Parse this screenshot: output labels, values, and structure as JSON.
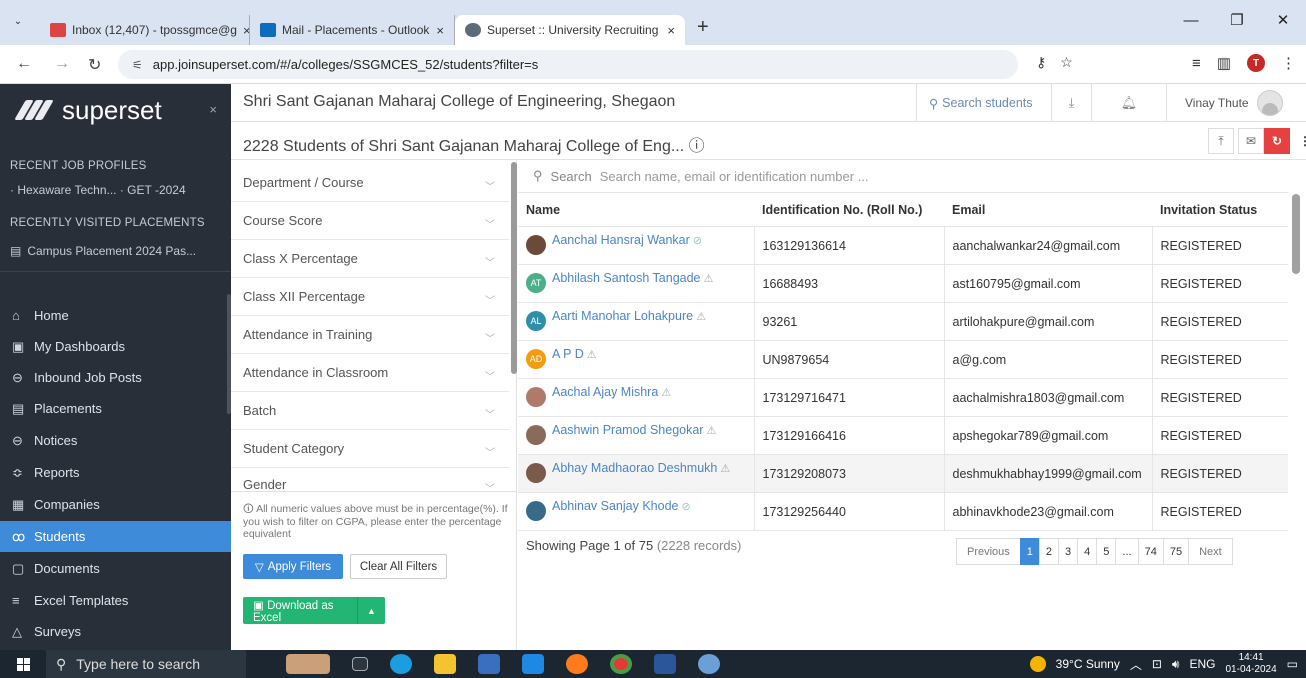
{
  "browser": {
    "tabs": [
      {
        "title": "Inbox (12,407) - tpossgmce@g",
        "close": "×",
        "active": false,
        "fav_color": "#d44"
      },
      {
        "title": "Mail - Placements - Outlook",
        "close": "×",
        "active": false,
        "fav_color": "#0f6cbd"
      },
      {
        "title": "Superset :: University Recruiting",
        "close": "×",
        "active": true,
        "fav_color": "#5c6b7a"
      }
    ],
    "new_tab": "+",
    "url": "app.joinsuperset.com/#/a/colleges/SSGMCES_52/students?filter=s",
    "profile_initial": "T"
  },
  "sidebar": {
    "brand": "superset",
    "close": "×",
    "recent_job_profiles_title": "RECENT JOB PROFILES",
    "recent_job_profile": "· Hexaware Techn...  · GET -2024",
    "recent_placements_title": "RECENTLY VISITED PLACEMENTS",
    "recent_placement": "Campus Placement 2024 Pas...",
    "items": [
      {
        "label": "Home",
        "icon": "home-icon",
        "glyph": "⌂"
      },
      {
        "label": "My Dashboards",
        "icon": "dashboard-icon",
        "glyph": "▣"
      },
      {
        "label": "Inbound Job Posts",
        "icon": "inbox-icon",
        "glyph": "⊖"
      },
      {
        "label": "Placements",
        "icon": "placements-icon",
        "glyph": "▤"
      },
      {
        "label": "Notices",
        "icon": "notices-icon",
        "glyph": "⊖"
      },
      {
        "label": "Reports",
        "icon": "reports-icon",
        "glyph": "≎"
      },
      {
        "label": "Companies",
        "icon": "companies-icon",
        "glyph": "▦"
      },
      {
        "label": "Students",
        "icon": "students-icon",
        "glyph": "ꝏ"
      },
      {
        "label": "Documents",
        "icon": "documents-icon",
        "glyph": "▢"
      },
      {
        "label": "Excel Templates",
        "icon": "templates-icon",
        "glyph": "≡"
      },
      {
        "label": "Surveys",
        "icon": "surveys-icon",
        "glyph": "△"
      }
    ],
    "active_item": "Students"
  },
  "header": {
    "college_name": "Shri Sant Gajanan Maharaj College of Engineering, Shegaon",
    "search_label": "Search students",
    "user_name": "Vinay Thute"
  },
  "subheader": {
    "title": "2228 Students of Shri Sant Gajanan Maharaj College of Eng... ⓘ"
  },
  "filters": {
    "items": [
      "Department / Course",
      "Course Score",
      "Class X Percentage",
      "Class XII Percentage",
      "Attendance in Training",
      "Attendance in Classroom",
      "Batch",
      "Student Category",
      "Gender"
    ],
    "note": "All numeric values above must be in percentage(%). If you wish to filter on CGPA, please enter the percentage equivalent",
    "apply_label": "Apply Filters",
    "clear_label": "Clear All Filters",
    "download_label": "Download as Excel"
  },
  "table": {
    "search_label": "Search",
    "search_placeholder": "Search name, email or identification number ...",
    "columns": [
      "Name",
      "Identification No. (Roll No.)",
      "Email",
      "Invitation Status"
    ],
    "rows": [
      {
        "name": "Aanchal Hansraj Wankar",
        "mark": "⊘",
        "mark_type": "ok",
        "avatar": "photo",
        "avatar_color": "#6b4a3a",
        "id": "163129136614",
        "email": "aanchalwankar24@gmail.com",
        "status": "REGISTERED"
      },
      {
        "name": "Abhilash Santosh Tangade",
        "mark": "⚠",
        "mark_type": "warn",
        "avatar": "AT",
        "avatar_color": "#4caf8a",
        "id": "16688493",
        "email": "ast160795@gmail.com",
        "status": "REGISTERED"
      },
      {
        "name": "Aarti Manohar Lohakpure",
        "mark": "⚠",
        "mark_type": "warn",
        "avatar": "AL",
        "avatar_color": "#2f8fa8",
        "id": "93261",
        "email": "artilohakpure@gmail.com",
        "status": "REGISTERED"
      },
      {
        "name": "A P D",
        "mark": "⚠",
        "mark_type": "warn",
        "avatar": "AD",
        "avatar_color": "#f39c12",
        "id": "UN9879654",
        "email": "a@g.com",
        "status": "REGISTERED"
      },
      {
        "name": "Aachal Ajay Mishra",
        "mark": "⚠",
        "mark_type": "warn",
        "avatar": "photo",
        "avatar_color": "#b07a6a",
        "id": "173129716471",
        "email": "aachalmishra1803@gmail.com",
        "status": "REGISTERED"
      },
      {
        "name": "Aashwin Pramod Shegokar",
        "mark": "⚠",
        "mark_type": "warn",
        "avatar": "photo",
        "avatar_color": "#8a6a5a",
        "id": "173129166416",
        "email": "apshegokar789@gmail.com",
        "status": "REGISTERED"
      },
      {
        "name": "Abhay Madhaorao Deshmukh",
        "mark": "⚠",
        "mark_type": "warn",
        "avatar": "photo",
        "avatar_color": "#7a5a4a",
        "id": "173129208073",
        "email": "deshmukhabhay1999@gmail.com",
        "status": "REGISTERED"
      },
      {
        "name": "Abhinav Sanjay Khode",
        "mark": "⊘",
        "mark_type": "ok",
        "avatar": "photo",
        "avatar_color": "#3a6a8a",
        "id": "173129256440",
        "email": "abhinavkhode23@gmail.com",
        "status": "REGISTERED"
      }
    ],
    "showing_prefix": "Showing Page 1 of 75",
    "showing_records": "(2228 records)"
  },
  "pagination": {
    "previous": "Previous",
    "pages": [
      "1",
      "2",
      "3",
      "4",
      "5",
      "...",
      "74",
      "75"
    ],
    "current": "1",
    "next": "Next"
  },
  "taskbar": {
    "search_placeholder": "Type here to search",
    "weather": "39°C  Sunny",
    "lang": "ENG",
    "time": "14:41",
    "date": "01-04-2024"
  },
  "colors": {
    "accent": "#3d8bd9",
    "sidebar_bg": "#282f38",
    "download_green": "#22b573",
    "sync_red": "#e64040"
  }
}
